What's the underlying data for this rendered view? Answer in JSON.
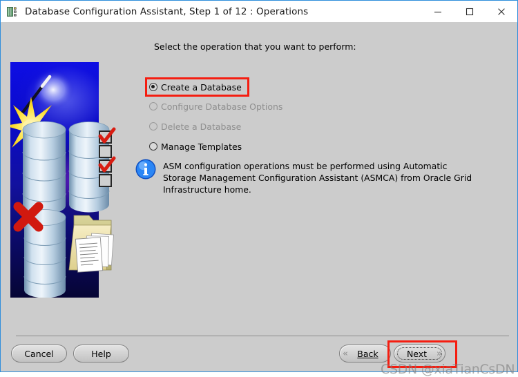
{
  "window": {
    "title": "Database Configuration Assistant, Step 1 of 12 : Operations",
    "icon": "database-assistant-icon",
    "controls": {
      "minimize": "minimize-icon",
      "maximize": "maximize-icon",
      "close": "close-icon"
    }
  },
  "main": {
    "prompt": "Select the operation that you want to perform:",
    "options": [
      {
        "label": "Create a Database",
        "selected": true,
        "disabled": false,
        "highlighted": true
      },
      {
        "label": "Configure Database Options",
        "selected": false,
        "disabled": true,
        "highlighted": false
      },
      {
        "label": "Delete a Database",
        "selected": false,
        "disabled": true,
        "highlighted": false
      },
      {
        "label": "Manage Templates",
        "selected": false,
        "disabled": false,
        "highlighted": false
      }
    ],
    "note": {
      "icon": "info-icon",
      "text": "ASM configuration operations must be performed using Automatic Storage Management Configuration Assistant (ASMCA) from Oracle Grid Infrastructure home."
    },
    "illustration": {
      "name": "database-operations-illustration",
      "elements": [
        "magic-wand-icon",
        "star-burst-icon",
        "database-cylinder-icon",
        "checklist-icon",
        "red-x-icon",
        "folder-documents-icon"
      ]
    }
  },
  "footer": {
    "cancel_label": "Cancel",
    "help_label": "Help",
    "back_label": "Back",
    "back_accel": "B",
    "next_label": "Next",
    "next_accel": "N",
    "back_arrow": "«",
    "next_arrow": "»",
    "next_highlighted": true,
    "next_focused": true
  },
  "watermark": {
    "text": "CSDN @xiaTianCsDN"
  },
  "colors": {
    "highlight_red": "#f51d10",
    "window_border_blue": "#2d8ddb",
    "dialog_gray": "#cccccc",
    "info_blue": "#1f7ff0"
  }
}
